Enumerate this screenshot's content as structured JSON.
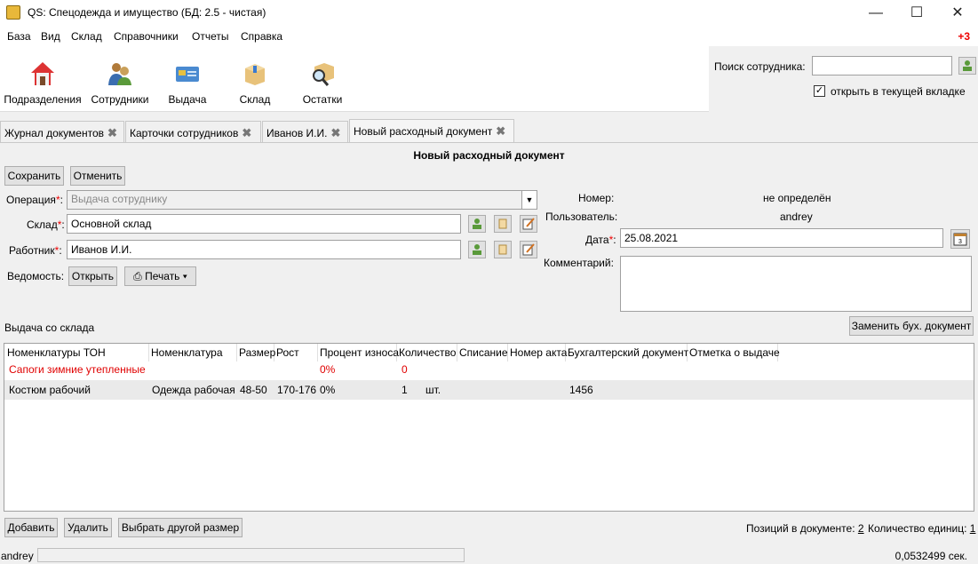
{
  "window": {
    "title": "QS: Спецодежда и имущество (БД: 2.5 - чистая)"
  },
  "menu": [
    "База",
    "Вид",
    "Склад",
    "Справочники",
    "Отчеты",
    "Справка"
  ],
  "notifications": "+3",
  "toolbar": {
    "items": [
      {
        "label": "Подразделения",
        "icon": "house-icon"
      },
      {
        "label": "Сотрудники",
        "icon": "people-icon"
      },
      {
        "label": "Выдача",
        "icon": "card-icon"
      },
      {
        "label": "Склад",
        "icon": "box-icon"
      },
      {
        "label": "Остатки",
        "icon": "magnifier-box-icon"
      }
    ]
  },
  "search": {
    "label": "Поиск сотрудника:",
    "value": "",
    "open_current_label": "открыть в текущей вкладке",
    "open_current_checked": true
  },
  "tabs": [
    {
      "label": "Журнал документов"
    },
    {
      "label": "Карточки сотрудников"
    },
    {
      "label": "Иванов И.И."
    },
    {
      "label": "Новый расходный документ",
      "active": true
    }
  ],
  "doc": {
    "title": "Новый расходный документ",
    "save_label": "Сохранить",
    "cancel_label": "Отменить",
    "operation_label": "Операция",
    "operation_value": "Выдача сотруднику",
    "warehouse_label": "Склад",
    "warehouse_value": "Основной склад",
    "worker_label": "Работник",
    "worker_value": "Иванов И.И.",
    "statement_label": "Ведомость:",
    "open_label": "Открыть",
    "print_label": "Печать",
    "number_label": "Номер:",
    "number_value": "не определён",
    "user_label": "Пользователь:",
    "user_value": "andrey",
    "date_label": "Дата",
    "date_value": "25.08.2021",
    "comment_label": "Комментарий:",
    "comment_value": "",
    "section_label": "Выдача со склада",
    "replace_doc_label": "Заменить бух. документ"
  },
  "grid": {
    "columns": [
      "Номенклатуры ТОН",
      "Номенклатура",
      "Размер",
      "Рост",
      "Процент износа",
      "Количество",
      "Списание",
      "Номер акта",
      "Бухгалтерский документ",
      "Отметка о выдаче"
    ],
    "rows": [
      {
        "ton": "Сапоги зимние утепленные",
        "nom": "",
        "size": "",
        "height": "",
        "wear": "0%",
        "qty": "0",
        "unit": "",
        "writeoff": "",
        "act": "",
        "accdoc": "",
        "mark": "",
        "highlight": "#e00000"
      },
      {
        "ton": "Костюм рабочий",
        "nom": "Одежда рабочая",
        "size": "48-50",
        "height": "170-176",
        "wear": "0%",
        "qty": "1",
        "unit": "шт.",
        "writeoff": "",
        "act": "",
        "accdoc": "1456",
        "mark": ""
      }
    ]
  },
  "bottom": {
    "add_label": "Добавить",
    "delete_label": "Удалить",
    "other_size_label": "Выбрать другой размер",
    "positions_label": "Позиций в документе:",
    "positions_value": "2",
    "units_label": "Количество единиц:",
    "units_value": "1"
  },
  "status": {
    "user": "andrey",
    "time": "0,0532499 сек."
  }
}
